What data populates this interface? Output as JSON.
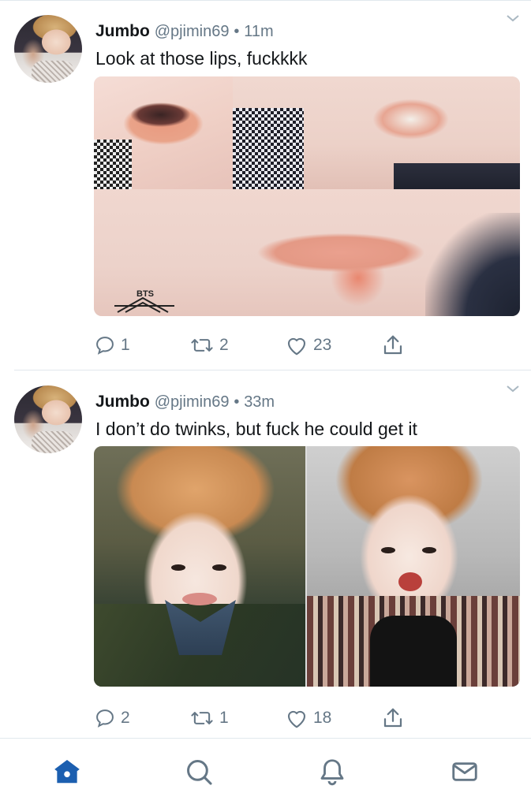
{
  "tweets": [
    {
      "name": "Jumbo",
      "handle": "@pjimin69",
      "separator": "•",
      "time": "11m",
      "text": "Look at those lips, fuckkkk",
      "media_text": "BTS",
      "replies": "1",
      "retweets": "2",
      "likes": "23"
    },
    {
      "name": "Jumbo",
      "handle": "@pjimin69",
      "separator": "•",
      "time": "33m",
      "text": "I don’t do twinks, but fuck he could get it",
      "replies": "2",
      "retweets": "1",
      "likes": "18"
    }
  ],
  "colors": {
    "accent": "#1da1f2",
    "home_active": "#1c5fb0",
    "muted": "#657786",
    "text": "#14171a",
    "divider": "#e1e8ed"
  },
  "tabbar": {
    "items": [
      "home-icon",
      "search-icon",
      "notifications-icon",
      "messages-icon"
    ],
    "active": "home-icon"
  }
}
